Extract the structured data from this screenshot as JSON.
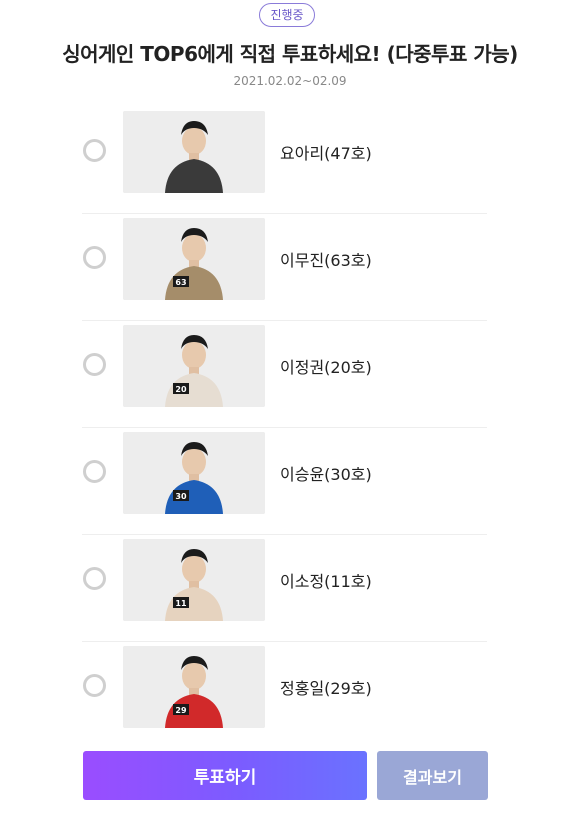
{
  "poll": {
    "status": "진행중",
    "title": "싱어게인 TOP6에게 직접 투표하세요! (다중투표 가능)",
    "period": "2021.02.02~02.09"
  },
  "options": [
    {
      "label": "요아리(47호)",
      "thumb_alt": "요아리 photo",
      "outfit_color": "#3a3a3a",
      "number_tag": ""
    },
    {
      "label": "이무진(63호)",
      "thumb_alt": "이무진 photo",
      "outfit_color": "#a58d6a",
      "number_tag": "63"
    },
    {
      "label": "이정권(20호)",
      "thumb_alt": "이정권 photo",
      "outfit_color": "#e6ddd2",
      "number_tag": "20"
    },
    {
      "label": "이승윤(30호)",
      "thumb_alt": "이승윤 photo",
      "outfit_color": "#1f5fb8",
      "number_tag": "30"
    },
    {
      "label": "이소정(11호)",
      "thumb_alt": "이소정 photo",
      "outfit_color": "#e6d3bf",
      "number_tag": "11"
    },
    {
      "label": "정홍일(29호)",
      "thumb_alt": "정홍일 photo",
      "outfit_color": "#d1292a",
      "number_tag": "29"
    }
  ],
  "buttons": {
    "vote": "투표하기",
    "results": "결과보기"
  }
}
